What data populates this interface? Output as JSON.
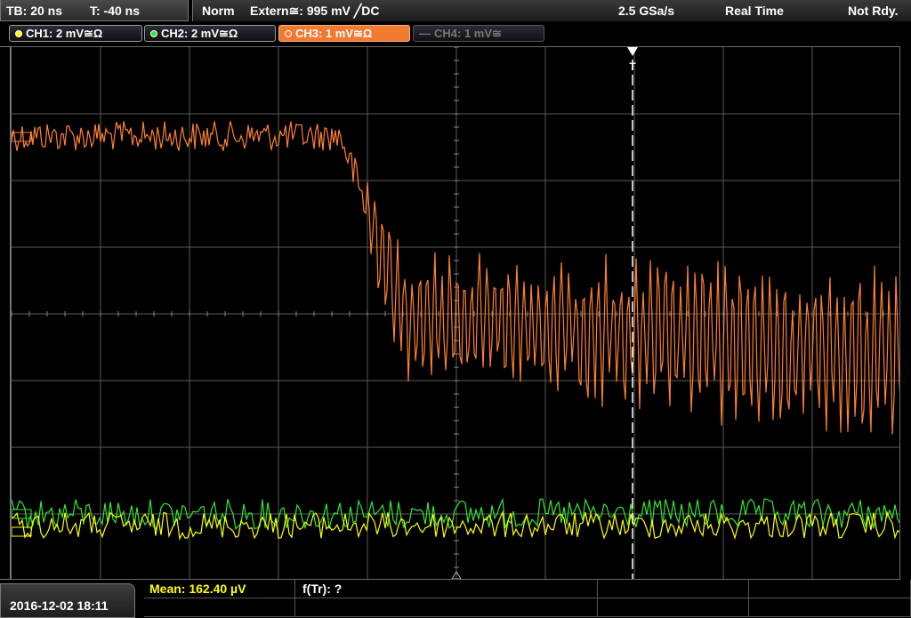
{
  "header": {
    "timebase": "TB: 20 ns",
    "trigger_time": "T: -40 ns",
    "mode": "Norm",
    "trigger_source": "Extern≅: 995 mV ╱DC",
    "sample_rate": "2.5 GSa/s",
    "acq_mode": "Real Time",
    "status": "Not Rdy."
  },
  "channels": [
    {
      "label": "CH1: 2 mV≅Ω",
      "color": "#ffff00",
      "active": false,
      "enabled": true
    },
    {
      "label": "CH2: 2 mV≅Ω",
      "color": "#33e633",
      "active": false,
      "enabled": true
    },
    {
      "label": "CH3: 1 mV≅Ω",
      "color": "#ff8030",
      "active": true,
      "enabled": true
    },
    {
      "label": "CH4: 1 mV≅",
      "color": "#777777",
      "active": false,
      "enabled": false
    }
  ],
  "trigger_marker": "T",
  "footer": {
    "datetime": "2016-12-02 18:11",
    "mean_label": "Mean: 162.40 µV",
    "rise_label": "f(Tr): ?"
  },
  "colors": {
    "ch1": "#ffff00",
    "ch2": "#33e633",
    "ch3": "#ff8030",
    "grid": "#5a5a5a",
    "trigger_line": "#ffffff"
  }
}
